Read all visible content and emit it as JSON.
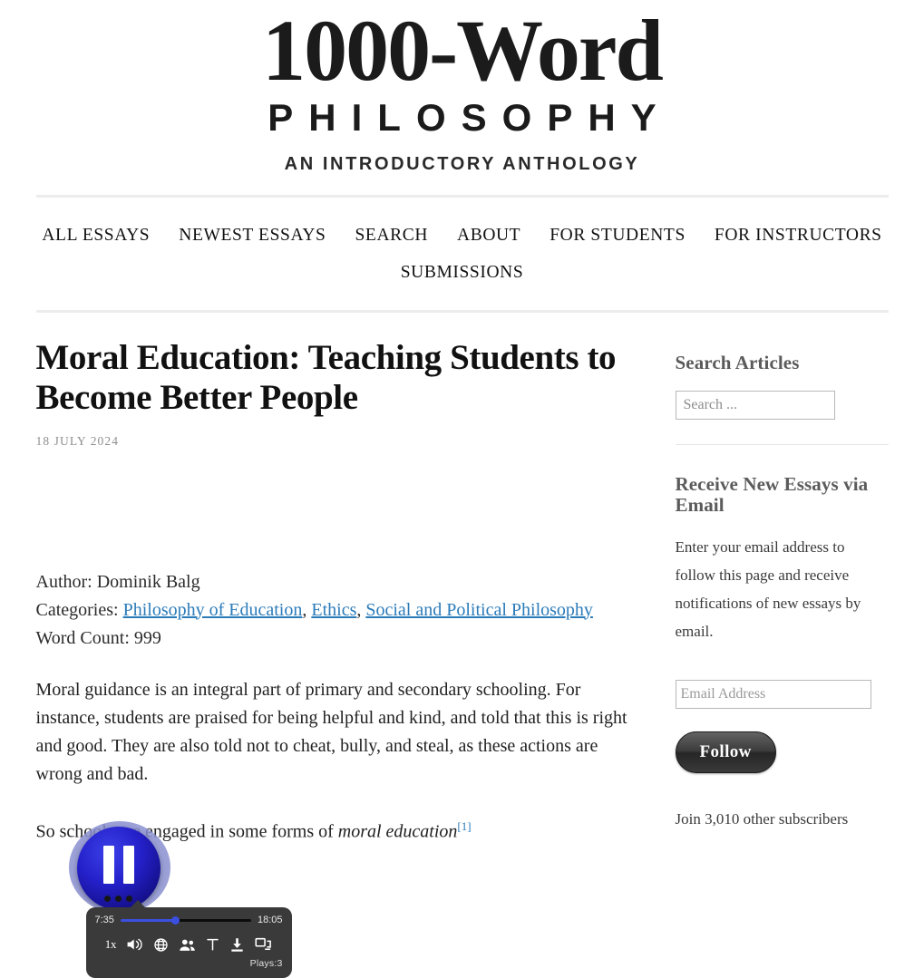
{
  "site": {
    "logo_line1": "1000-Word",
    "logo_line2": "PHILOSOPHY",
    "logo_tagline": "AN INTRODUCTORY ANTHOLOGY"
  },
  "nav": {
    "row1": [
      {
        "label": "ALL ESSAYS"
      },
      {
        "label": "NEWEST ESSAYS"
      },
      {
        "label": "SEARCH"
      },
      {
        "label": "ABOUT"
      },
      {
        "label": "FOR STUDENTS"
      },
      {
        "label": "FOR INSTRUCTORS"
      }
    ],
    "row2": [
      {
        "label": "SUBMISSIONS"
      }
    ]
  },
  "article": {
    "title": "Moral Education: Teaching Students to Become Better People",
    "date": "18 JULY 2024",
    "author_label": "Author:",
    "author_name": "Dominik Balg",
    "categories_label": "Categories:",
    "categories": [
      "Philosophy of Education",
      "Ethics",
      "Social and Political Philosophy"
    ],
    "word_count_label": "Word Count:",
    "word_count": "999",
    "paragraph_1": "Moral guidance is an integral part of primary and secondary schooling. For instance, students are praised for being helpful and kind, and told that this is right and good. They are also told not to cheat, bully, and steal, as these actions are wrong and bad.",
    "paragraph_2_pre": "So schools are engaged in some forms of ",
    "paragraph_2_em": "moral education",
    "paragraph_2_ref": "[1]"
  },
  "audio_player": {
    "state": "playing",
    "current_time": "7:35",
    "total_time": "18:05",
    "progress_percent": 42,
    "speed_label": "1x",
    "plays_label": "Plays:3",
    "controls": [
      "speed-control",
      "volume-icon",
      "globe-icon",
      "voices-icon",
      "text-icon",
      "download-icon",
      "embed-icon"
    ],
    "accent_color": "#3b4fe0",
    "panel_color": "#3a3a3a"
  },
  "sidebar": {
    "search_widget": {
      "title": "Search Articles",
      "placeholder": "Search ...",
      "value": ""
    },
    "subscribe_widget": {
      "title": "Receive New Essays via Email",
      "blurb": "Enter your email address to follow this page and receive notifications of new essays by email.",
      "email_placeholder": "Email Address",
      "email_value": "",
      "follow_label": "Follow",
      "subscriber_text": "Join 3,010 other subscribers"
    }
  },
  "colors": {
    "link": "#2b7bb9",
    "rule": "#ececec",
    "muted_text": "#8e8e8e"
  }
}
